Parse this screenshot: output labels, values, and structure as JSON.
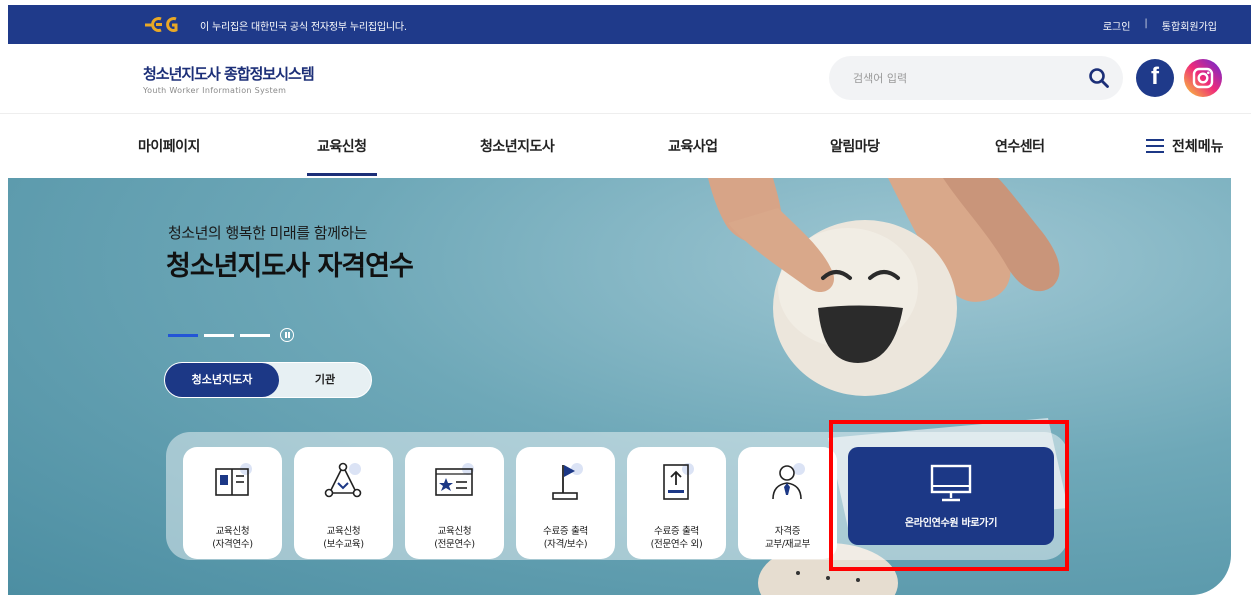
{
  "gov_banner": {
    "text": "이 누리집은 대한민국 공식 전자정부 누리집입니다.",
    "login": "로그인",
    "separator": "|",
    "signup": "통합회원가입",
    "logo_icon": "eg-logo-icon"
  },
  "brand": {
    "title": "청소년지도사 종합정보시스템",
    "subtitle": "Youth Worker Information System"
  },
  "search": {
    "placeholder": "검색어 입력",
    "icon": "search-icon"
  },
  "sns": {
    "facebook_glyph": "f",
    "instagram_icon": "instagram-icon"
  },
  "nav": {
    "items": [
      "마이페이지",
      "교육신청",
      "청소년지도사",
      "교육사업",
      "알림마당",
      "연수센터"
    ],
    "active": "교육신청",
    "all_menu": "전체메뉴"
  },
  "hero": {
    "subtitle": "청소년의 행복한 미래를 함께하는",
    "title": "청소년지도사 자격연수",
    "slide_count": 3,
    "active_slide": 1
  },
  "toggle": {
    "option_a": "청소년지도자",
    "option_b": "기관",
    "selected": "청소년지도자"
  },
  "quick_menu": {
    "cards": [
      {
        "line1": "교육신청",
        "line2": "(자격연수)",
        "icon": "book-icon"
      },
      {
        "line1": "교육신청",
        "line2": "(보수교육)",
        "icon": "network-icon"
      },
      {
        "line1": "교육신청",
        "line2": "(전문연수)",
        "icon": "star-card-icon"
      },
      {
        "line1": "수료증 출력",
        "line2": "(자격/보수)",
        "icon": "flag-icon"
      },
      {
        "line1": "수료증 출력",
        "line2": "(전문연수 외)",
        "icon": "upload-icon"
      },
      {
        "line1": "자격증",
        "line2": "교부/재교부",
        "icon": "person-tie-icon"
      }
    ],
    "big_card": {
      "label": "온라인연수원 바로가기",
      "icon": "monitor-icon"
    }
  },
  "colors": {
    "primary": "#1c3886",
    "gov_bar": "#1f3a8a",
    "highlight": "#ff0000",
    "pager_active": "#2355d6"
  }
}
